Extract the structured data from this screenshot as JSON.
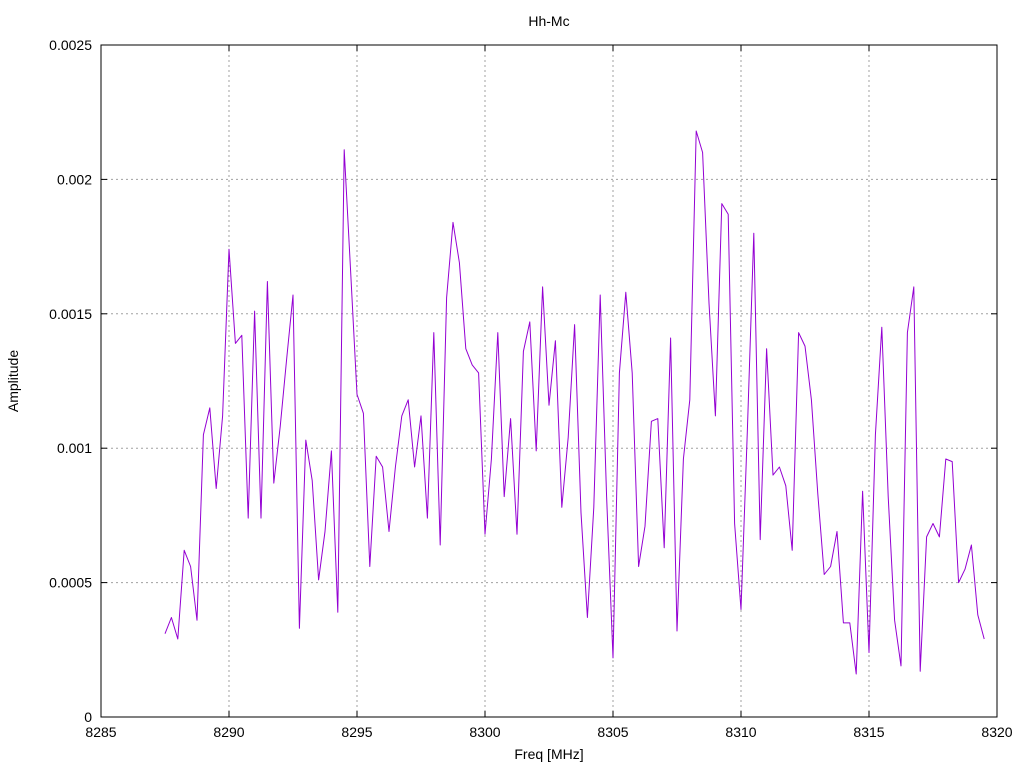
{
  "chart_data": {
    "type": "line",
    "title": "Hh-Mc",
    "xlabel": "Freq [MHz]",
    "ylabel": "Amplitude",
    "xlim": [
      8285,
      8320
    ],
    "ylim": [
      0,
      0.0025
    ],
    "xticks": [
      8285,
      8290,
      8295,
      8300,
      8305,
      8310,
      8315,
      8320
    ],
    "yticks": [
      0,
      0.0005,
      0.001,
      0.0015,
      0.002,
      0.0025
    ],
    "ytick_labels": [
      "0",
      "0.0005",
      "0.001",
      "0.0015",
      "0.002",
      "0.0025"
    ],
    "grid": true,
    "line_color": "#9400d3",
    "series": [
      {
        "x": [
          8287.5,
          8287.75,
          8288.0,
          8288.25,
          8288.5,
          8288.75,
          8289.0,
          8289.25,
          8289.5,
          8289.75,
          8290.0,
          8290.25,
          8290.5,
          8290.75,
          8291.0,
          8291.25,
          8291.5,
          8291.75,
          8292.0,
          8292.25,
          8292.5,
          8292.75,
          8293.0,
          8293.25,
          8293.5,
          8293.75,
          8294.0,
          8294.25,
          8294.5,
          8294.75,
          8295.0,
          8295.25,
          8295.5,
          8295.75,
          8296.0,
          8296.25,
          8296.5,
          8296.75,
          8297.0,
          8297.25,
          8297.5,
          8297.75,
          8298.0,
          8298.25,
          8298.5,
          8298.75,
          8299.0,
          8299.25,
          8299.5,
          8299.75,
          8300.0,
          8300.25,
          8300.5,
          8300.75,
          8301.0,
          8301.25,
          8301.5,
          8301.75,
          8302.0,
          8302.25,
          8302.5,
          8302.75,
          8303.0,
          8303.25,
          8303.5,
          8303.75,
          8304.0,
          8304.25,
          8304.5,
          8304.75,
          8305.0,
          8305.25,
          8305.5,
          8305.75,
          8306.0,
          8306.25,
          8306.5,
          8306.75,
          8307.0,
          8307.25,
          8307.5,
          8307.75,
          8308.0,
          8308.25,
          8308.5,
          8308.75,
          8309.0,
          8309.25,
          8309.5,
          8309.75,
          8310.0,
          8310.25,
          8310.5,
          8310.75,
          8311.0,
          8311.25,
          8311.5,
          8311.75,
          8312.0,
          8312.25,
          8312.5,
          8312.75,
          8313.0,
          8313.25,
          8313.5,
          8313.75,
          8314.0,
          8314.25,
          8314.5,
          8314.75,
          8315.0,
          8315.25,
          8315.5,
          8315.75,
          8316.0,
          8316.25,
          8316.5,
          8316.75,
          8317.0,
          8317.25,
          8317.5,
          8317.75,
          8318.0,
          8318.25,
          8318.5,
          8318.75,
          8319.0,
          8319.25,
          8319.5
        ],
        "values": [
          0.00031,
          0.00037,
          0.00029,
          0.00062,
          0.00056,
          0.00036,
          0.00105,
          0.00115,
          0.00085,
          0.00112,
          0.00174,
          0.00139,
          0.00142,
          0.00074,
          0.00151,
          0.00074,
          0.00162,
          0.00087,
          0.00108,
          0.00133,
          0.00157,
          0.00033,
          0.00103,
          0.00088,
          0.00051,
          0.00069,
          0.00099,
          0.00039,
          0.00211,
          0.00166,
          0.0012,
          0.00113,
          0.00056,
          0.00097,
          0.00093,
          0.00069,
          0.00093,
          0.00112,
          0.00118,
          0.00093,
          0.00112,
          0.00074,
          0.00143,
          0.00064,
          0.00156,
          0.00184,
          0.00169,
          0.00137,
          0.00131,
          0.00128,
          0.00068,
          0.00096,
          0.00143,
          0.00082,
          0.00111,
          0.00068,
          0.00136,
          0.00147,
          0.00099,
          0.0016,
          0.00116,
          0.0014,
          0.00078,
          0.00104,
          0.00146,
          0.00076,
          0.00037,
          0.00078,
          0.00157,
          0.00082,
          0.00022,
          0.00128,
          0.00158,
          0.00128,
          0.00056,
          0.00071,
          0.0011,
          0.00111,
          0.00063,
          0.00141,
          0.00032,
          0.00096,
          0.00118,
          0.00218,
          0.0021,
          0.00154,
          0.00112,
          0.00191,
          0.00187,
          0.00072,
          0.0004,
          0.00107,
          0.0018,
          0.00066,
          0.00137,
          0.0009,
          0.00093,
          0.00086,
          0.00062,
          0.00143,
          0.00138,
          0.00118,
          0.00083,
          0.00053,
          0.00056,
          0.00069,
          0.00035,
          0.00035,
          0.00016,
          0.00084,
          0.00024,
          0.00105,
          0.00145,
          0.00082,
          0.00036,
          0.00019,
          0.00143,
          0.0016,
          0.00017,
          0.00067,
          0.00072,
          0.00067,
          0.00096,
          0.00095,
          0.0005,
          0.00055,
          0.00064,
          0.00038,
          0.00029
        ]
      }
    ]
  }
}
